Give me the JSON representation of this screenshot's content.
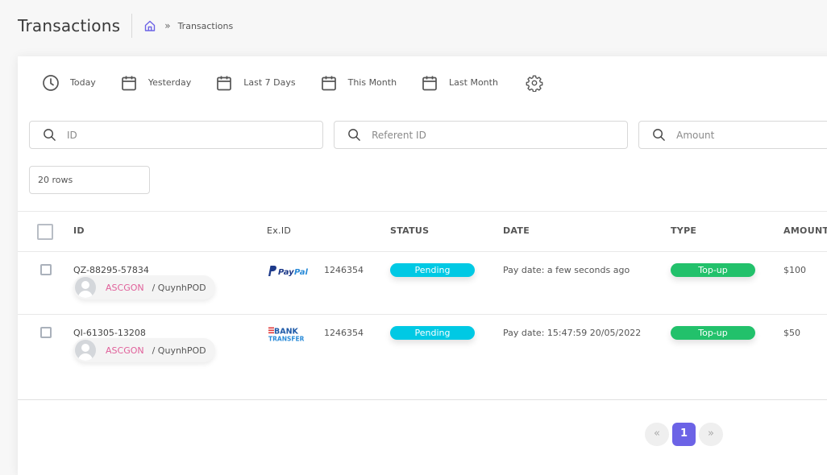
{
  "header": {
    "title": "Transactions",
    "breadcrumb": {
      "home_icon": "home-icon",
      "separator": "»",
      "current": "Transactions"
    }
  },
  "date_filters": [
    {
      "label": "Today",
      "icon": "clock-icon"
    },
    {
      "label": "Yesterday",
      "icon": "calendar-icon"
    },
    {
      "label": "Last 7 Days",
      "icon": "calendar-icon"
    },
    {
      "label": "This Month",
      "icon": "calendar-icon"
    },
    {
      "label": "Last Month",
      "icon": "calendar-icon"
    }
  ],
  "settings_icon": "gear-icon",
  "search": {
    "id_placeholder": "ID",
    "referent_placeholder": "Referent ID",
    "amount_placeholder": "Amount"
  },
  "rows_select": {
    "value": "20 rows"
  },
  "table": {
    "columns": [
      "ID",
      "Ex.ID",
      "STATUS",
      "DATE",
      "TYPE",
      "AMOUNT"
    ],
    "rows": [
      {
        "id": "QZ-88295-57834",
        "shop": "ASCGON",
        "user": "/ QuynhPOD",
        "gateway": "PayPal",
        "ex_id": "1246354",
        "status": "Pending",
        "date": "Pay date: a few seconds ago",
        "type": "Top-up",
        "amount": "$100"
      },
      {
        "id": "QI-61305-13208",
        "shop": "ASCGON",
        "user": "/ QuynhPOD",
        "gateway": "BANK TRANSFER",
        "ex_id": "1246354",
        "status": "Pending",
        "date": "Pay date: 15:47:59 20/05/2022",
        "type": "Top-up",
        "amount": "$50"
      }
    ]
  },
  "pagination": {
    "prev": "«",
    "current": "1",
    "next": "»"
  },
  "colors": {
    "accent": "#6c63e6",
    "status_pending": "#00c9e4",
    "type_topup": "#22c16b",
    "shop_name": "#e0609a"
  }
}
